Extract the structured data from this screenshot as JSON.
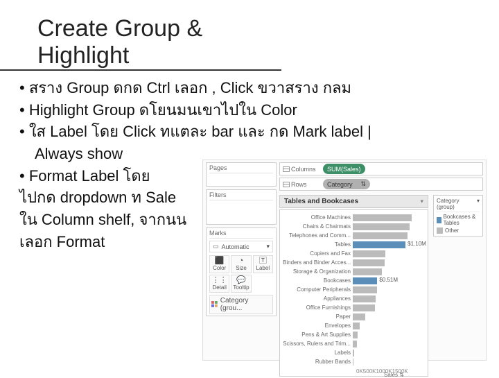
{
  "title": "Create Group & Highlight",
  "bullets": {
    "b1": "• สราง   Group ดกด   Ctrl เลอก  , Click ขวาสราง   กลม",
    "b2": "• Highlight Group ดโยนมนเขาไปใน       Color",
    "b3": "• ใส   Label โดย Click ทแตละ       bar และ กด Mark label |",
    "b3b": "Always show",
    "b4": "• Format Label โดย",
    "b5": "ไปกด dropdown ท     Sale",
    "b6": "ใน Column shelf, จากนน",
    "b7": "เลอก   Format"
  },
  "panel": {
    "pages": "Pages",
    "filters": "Filters",
    "marks": "Marks",
    "marks_auto": "Automatic",
    "mark_labels": [
      "Color",
      "Size",
      "Label",
      "Detail",
      "Tooltip"
    ],
    "cat_pill": "Category (grou...",
    "columns": "Columns",
    "rows": "Rows",
    "col_pill": "SUM(Sales)",
    "row_pill": "Category",
    "chart_title": "Tables and Bookcases",
    "legend_title": "Category (group)",
    "legend_items": [
      "Bookcases & Tables",
      "Other"
    ],
    "axis_ticks": [
      "0K",
      "500K",
      "1000K",
      "1500K"
    ],
    "axis_label": "Sales"
  },
  "chart_data": {
    "type": "bar",
    "orientation": "horizontal",
    "title": "Tables and Bookcases",
    "xlabel": "Sales",
    "ylabel": "Category",
    "xlim": [
      0,
      1500000
    ],
    "categories": [
      "Office Machines",
      "Chairs & Chairmats",
      "Telephones and Comm...",
      "Tables",
      "Copiers and Fax",
      "Binders and Binder Acces...",
      "Storage & Organization",
      "Bookcases",
      "Computer Peripherals",
      "Appliances",
      "Office Furnishings",
      "Paper",
      "Envelopes",
      "Pens & Art Supplies",
      "Scissors, Rulers and Trim...",
      "Labels",
      "Rubber Bands"
    ],
    "values": [
      1220000,
      1180000,
      1140000,
      1098000,
      680000,
      660000,
      610000,
      510000,
      500000,
      470000,
      460000,
      260000,
      150000,
      105000,
      85000,
      25000,
      15000
    ],
    "groups": [
      "Other",
      "Other",
      "Other",
      "Bookcases & Tables",
      "Other",
      "Other",
      "Other",
      "Bookcases & Tables",
      "Other",
      "Other",
      "Other",
      "Other",
      "Other",
      "Other",
      "Other",
      "Other",
      "Other"
    ],
    "shown_labels": {
      "Tables": "$1.10M",
      "Bookcases": "$0.51M"
    },
    "legend": [
      "Bookcases & Tables",
      "Other"
    ],
    "colors": {
      "Bookcases & Tables": "#5b8fb9",
      "Other": "#bbbbbb"
    }
  }
}
